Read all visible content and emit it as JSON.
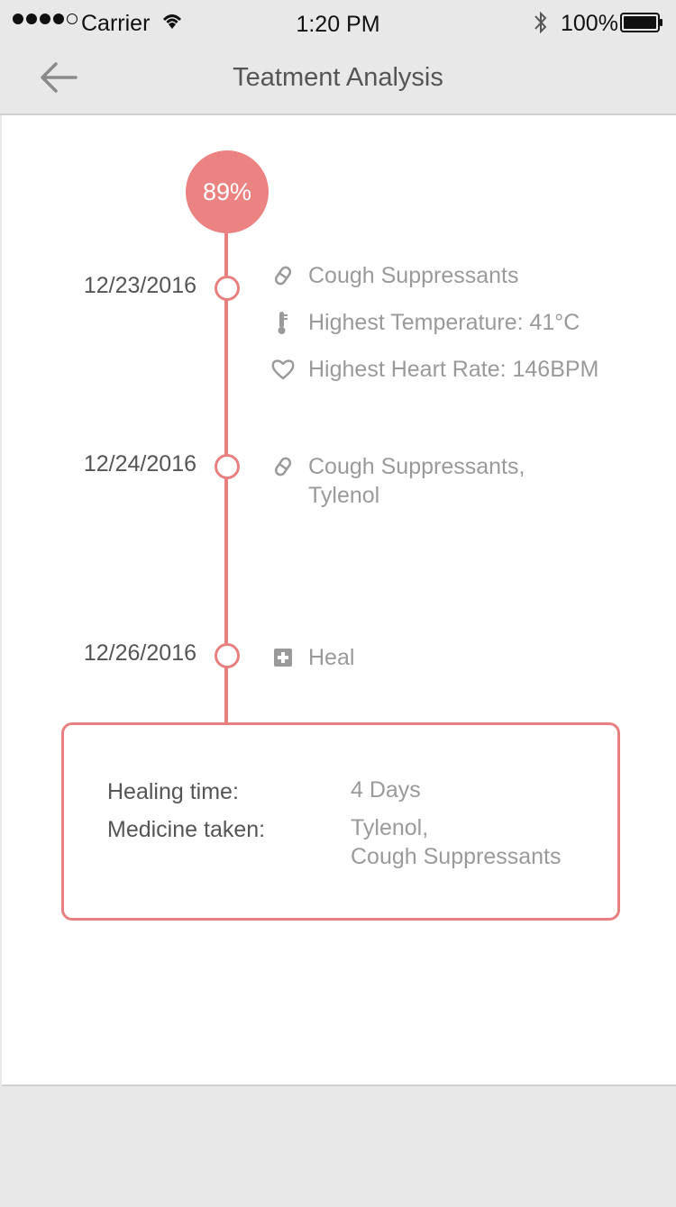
{
  "status_bar": {
    "carrier": "Carrier",
    "time": "1:20 PM",
    "battery": "100%"
  },
  "nav": {
    "title": "Teatment Analysis"
  },
  "score": "89%",
  "timeline": [
    {
      "date": "12/23/2016",
      "items": [
        {
          "icon": "pill-icon",
          "text": "Cough Suppressants"
        },
        {
          "icon": "thermometer-icon",
          "text": "Highest Temperature: 41°C"
        },
        {
          "icon": "heart-icon",
          "text": "Highest Heart Rate: 146BPM"
        }
      ]
    },
    {
      "date": "12/24/2016",
      "items": [
        {
          "icon": "pill-icon",
          "text": "Cough Suppressants, Tylenol"
        }
      ]
    },
    {
      "date": "12/26/2016",
      "items": [
        {
          "icon": "medical-cross-icon",
          "text": "Heal"
        }
      ]
    }
  ],
  "summary": {
    "healing_label": "Healing time:",
    "healing_value": "4 Days",
    "medicine_label": "Medicine taken:",
    "medicine_value_1": "Tylenol,",
    "medicine_value_2": "Cough Suppressants"
  },
  "colors": {
    "accent": "#e88080",
    "muted_text": "#9a9a9a",
    "background": "#e8e8e8"
  }
}
